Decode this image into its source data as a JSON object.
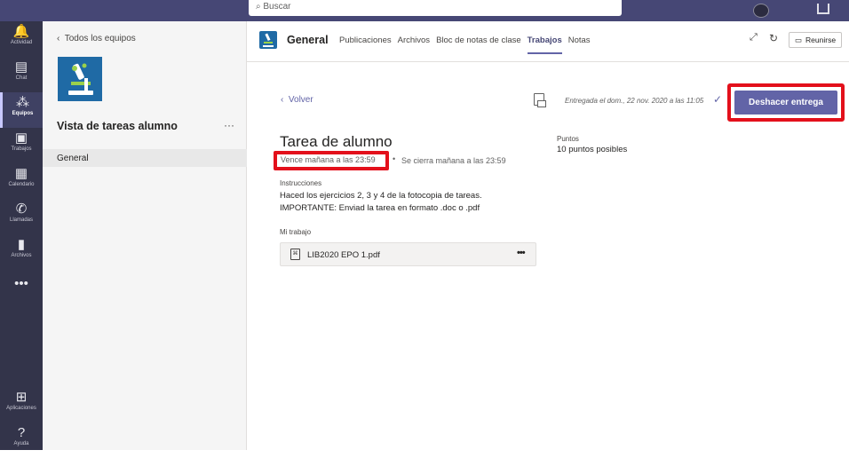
{
  "topbar": {
    "search_placeholder": "Buscar"
  },
  "rail": [
    {
      "icon": "🔔",
      "label": "Actividad"
    },
    {
      "icon": "▤",
      "label": "Chat"
    },
    {
      "icon": "⁂",
      "label": "Equipos"
    },
    {
      "icon": "▣",
      "label": "Trabajos"
    },
    {
      "icon": "▦",
      "label": "Calendario"
    },
    {
      "icon": "✆",
      "label": "Llamadas"
    },
    {
      "icon": "▮",
      "label": "Archivos"
    },
    {
      "icon": "•••",
      "label": ""
    },
    {
      "icon": "⊞",
      "label": "Aplicaciones"
    },
    {
      "icon": "?",
      "label": "Ayuda"
    }
  ],
  "team_panel": {
    "back_label": "Todos los equipos",
    "team_name": "Vista de tareas alumno",
    "more": "···",
    "channel": "General"
  },
  "channel_header": {
    "title": "General",
    "tabs": [
      "Publicaciones",
      "Archivos",
      "Bloc de notas de clase",
      "Trabajos",
      "Notas"
    ],
    "active_tab": "Trabajos",
    "meet_label": "Reunirse"
  },
  "assignment": {
    "back_label": "Volver",
    "submitted_text": "Entregada el dom., 22 nov. 2020 a las 11:05",
    "undo_button": "Deshacer entrega",
    "title": "Tarea de alumno",
    "due": "Vence mañana a las 23:59",
    "closes": "Se cierra mañana a las 23:59",
    "points_label": "Puntos",
    "points_value": "10 puntos posibles",
    "instructions_label": "Instrucciones",
    "instructions_line1": "Haced los ejercicios 2, 3 y 4 de la fotocopia de tareas.",
    "instructions_line2": "IMPORTANTE: Enviad la tarea en formato .doc o .pdf",
    "my_work_label": "Mi trabajo",
    "file_name": "LIB2020 EPO 1.pdf"
  },
  "colors": {
    "accent": "#6264a7",
    "highlight": "#e3101b",
    "rail": "#33344a"
  }
}
